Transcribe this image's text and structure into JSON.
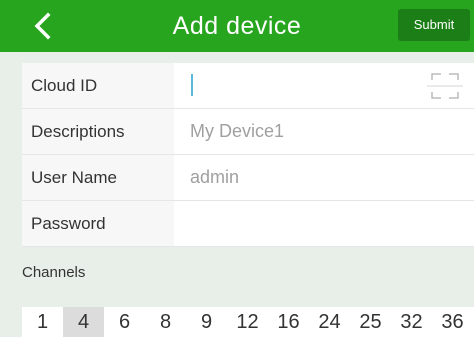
{
  "header": {
    "title": "Add device",
    "submit_label": "Submit",
    "back_icon": "chevron-left-icon",
    "colors": {
      "bar": "#27a51f",
      "submit": "#1b7e17",
      "text": "#ffffff"
    }
  },
  "form": {
    "cloud_id": {
      "label": "Cloud ID",
      "value": "",
      "placeholder": "",
      "icon": "scan-qr-icon"
    },
    "descriptions": {
      "label": "Descriptions",
      "value": "",
      "placeholder": "My Device1"
    },
    "user_name": {
      "label": "User Name",
      "value": "",
      "placeholder": "admin"
    },
    "password": {
      "label": "Password",
      "value": "",
      "placeholder": ""
    }
  },
  "channels": {
    "label": "Channels",
    "options": [
      "1",
      "4",
      "6",
      "8",
      "9",
      "12",
      "16",
      "24",
      "25",
      "32",
      "36"
    ],
    "selected": "4"
  }
}
